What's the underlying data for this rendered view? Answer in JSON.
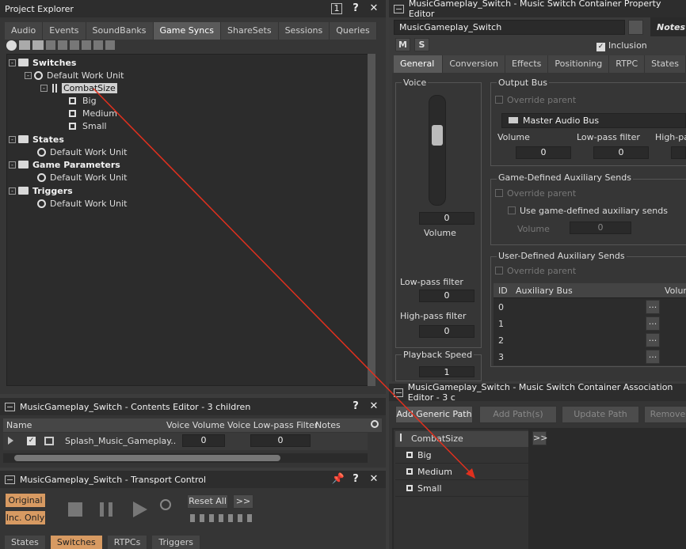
{
  "project_explorer": {
    "title": "Project Explorer",
    "tabs": [
      "Audio",
      "Events",
      "SoundBanks",
      "Game Syncs",
      "ShareSets",
      "Sessions",
      "Queries"
    ],
    "active_tab": "Game Syncs",
    "tree": {
      "switches": "Switches",
      "default_wu": "Default Work Unit",
      "combat_size": "CombatSize",
      "big": "Big",
      "medium": "Medium",
      "small": "Small",
      "states": "States",
      "game_parameters": "Game Parameters",
      "triggers": "Triggers"
    }
  },
  "property_editor": {
    "title": "MusicGameplay_Switch - Music Switch Container Property Editor",
    "name": "MusicGameplay_Switch",
    "notes": "Notes",
    "m": "M",
    "s": "S",
    "inclusion": "Inclusion",
    "tabs": [
      "General Settings",
      "Conversion",
      "Effects",
      "Positioning",
      "RTPC",
      "States"
    ],
    "voice": "Voice",
    "volume_label": "Volume",
    "volume_value": "0",
    "lowpass_label": "Low-pass filter",
    "lowpass_value": "0",
    "highpass_label": "High-pass filter",
    "highpass_value": "0",
    "playback_speed": "Playback Speed",
    "playback_value": "1",
    "output_bus": "Output Bus",
    "override_parent": "Override parent",
    "master_bus": "Master Audio Bus",
    "ob_volume": "Volume",
    "ob_volume_value": "0",
    "ob_lowpass": "Low-pass filter",
    "ob_lowpass_value": "0",
    "ob_highpass": "High-pas",
    "game_aux": "Game-Defined Auxiliary Sends",
    "use_game_aux": "Use game-defined auxiliary sends",
    "ga_volume": "Volume",
    "ga_volume_value": "0",
    "user_aux": "User-Defined Auxiliary Sends",
    "aux_cols": [
      "ID",
      "Auxiliary Bus",
      "Volum"
    ],
    "aux_ids": [
      "0",
      "1",
      "2",
      "3"
    ],
    "ellipsis": "..."
  },
  "contents_editor": {
    "title": "MusicGameplay_Switch - Contents Editor - 3 children",
    "cols": [
      "Name",
      "Voice Volume",
      "Voice Low-pass Filter",
      "Notes"
    ],
    "row_name": "Splash_Music_Gameplay..",
    "row_vol": "0",
    "row_lpf": "0"
  },
  "transport": {
    "title": "MusicGameplay_Switch - Transport Control",
    "original": "Original",
    "inc_only": "Inc. Only",
    "reset_all": "Reset All",
    "more": ">>",
    "tabs": [
      "States",
      "Switches",
      "RTPCs",
      "Triggers"
    ],
    "active_tab": "Switches"
  },
  "assoc_editor": {
    "title": "MusicGameplay_Switch - Music Switch Container Association Editor - 3 c",
    "buttons": [
      "Add Generic Path",
      "Add Path(s)",
      "Update Path",
      "Remove"
    ],
    "expand": ">>",
    "items": [
      "CombatSize",
      "Big",
      "Medium",
      "Small"
    ]
  },
  "colors": {
    "accent": "#d79a62",
    "arrow": "#e0301e"
  }
}
